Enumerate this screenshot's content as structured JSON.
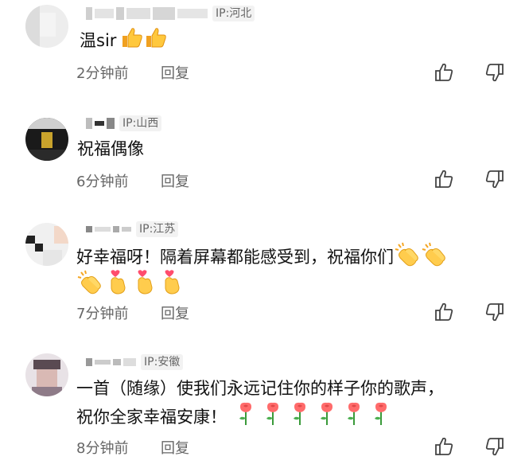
{
  "comments": [
    {
      "ip": "IP:河北",
      "text": "温sir",
      "emojis": [
        "thumbs-up-icon",
        "thumbs-up-icon"
      ],
      "time": "2分钟前",
      "reply": "回复"
    },
    {
      "ip": "IP:山西",
      "text": "祝福偶像",
      "time": "6分钟前",
      "reply": "回复"
    },
    {
      "ip": "IP:江苏",
      "text_line1": "好幸福呀！隔着屏幕都能感受到，祝福你们",
      "emojis_line1": [
        "clapping-hands-icon",
        "clapping-hands-icon"
      ],
      "emojis_line2": [
        "clapping-hands-icon",
        "finger-heart-icon",
        "finger-heart-icon",
        "finger-heart-icon"
      ],
      "time": "7分钟前",
      "reply": "回复"
    },
    {
      "ip": "IP:安徽",
      "text_line1": "一首（随缘）使我们永远记住你的样子你的歌声，",
      "text_line2": "祝你全家幸福安康！",
      "emojis_line2": [
        "rose-icon",
        "rose-icon",
        "rose-icon",
        "rose-icon",
        "rose-icon",
        "rose-icon"
      ],
      "time": "8分钟前",
      "reply": "回复"
    }
  ],
  "colors": {
    "meta_text": "#666666",
    "ip_bg": "#f2f2f2",
    "text": "#111111"
  }
}
